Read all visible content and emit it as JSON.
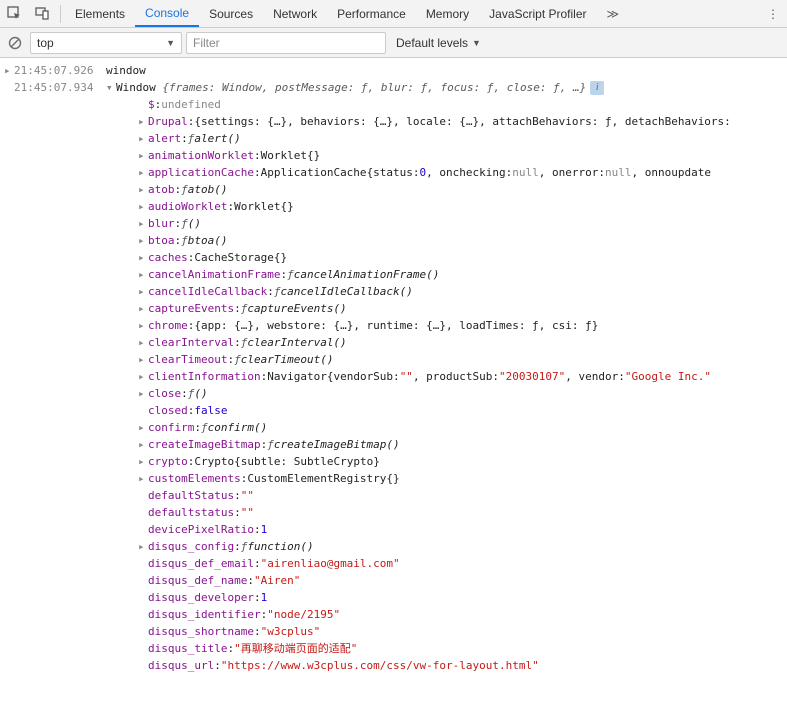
{
  "tabs": {
    "elements": "Elements",
    "console": "Console",
    "sources": "Sources",
    "network": "Network",
    "performance": "Performance",
    "memory": "Memory",
    "profiler": "JavaScript Profiler",
    "more": "≫"
  },
  "subbar": {
    "context": "top",
    "filter_placeholder": "Filter",
    "levels": "Default levels"
  },
  "log1": {
    "ts": "21:45:07.926",
    "text": "window"
  },
  "log2": {
    "ts": "21:45:07.934",
    "header_pre": "Window ",
    "header_body": "{frames: Window, postMessage: ƒ, blur: ƒ, focus: ƒ, close: ƒ, …}"
  },
  "props": {
    "dollar": {
      "k": "$",
      "v": "undefined"
    },
    "drupal": {
      "k": "Drupal",
      "v": "{settings: {…}, behaviors: {…}, locale: {…}, attachBehaviors: ƒ, detachBehaviors:"
    },
    "alert": {
      "k": "alert",
      "f": "ƒ ",
      "fn": "alert()"
    },
    "animationWorklet": {
      "k": "animationWorklet",
      "t": "Worklet ",
      "v": "{}"
    },
    "applicationCache": {
      "k": "applicationCache",
      "t": "ApplicationCache ",
      "v": "{status: ",
      "num": "0",
      "v2": ", onchecking: ",
      "n1": "null",
      "v3": ", onerror: ",
      "n2": "null",
      "v4": ", onnoupdate"
    },
    "atob": {
      "k": "atob",
      "f": "ƒ ",
      "fn": "atob()"
    },
    "audioWorklet": {
      "k": "audioWorklet",
      "t": "Worklet ",
      "v": "{}"
    },
    "blur": {
      "k": "blur",
      "f": "ƒ ",
      "fn": "()"
    },
    "btoa": {
      "k": "btoa",
      "f": "ƒ ",
      "fn": "btoa()"
    },
    "caches": {
      "k": "caches",
      "t": "CacheStorage ",
      "v": "{}"
    },
    "cancelAnimationFrame": {
      "k": "cancelAnimationFrame",
      "f": "ƒ ",
      "fn": "cancelAnimationFrame()"
    },
    "cancelIdleCallback": {
      "k": "cancelIdleCallback",
      "f": "ƒ ",
      "fn": "cancelIdleCallback()"
    },
    "captureEvents": {
      "k": "captureEvents",
      "f": "ƒ ",
      "fn": "captureEvents()"
    },
    "chrome": {
      "k": "chrome",
      "v": "{app: {…}, webstore: {…}, runtime: {…}, loadTimes: ƒ, csi: ƒ}"
    },
    "clearInterval": {
      "k": "clearInterval",
      "f": "ƒ ",
      "fn": "clearInterval()"
    },
    "clearTimeout": {
      "k": "clearTimeout",
      "f": "ƒ ",
      "fn": "clearTimeout()"
    },
    "clientInformation": {
      "k": "clientInformation",
      "t": "Navigator ",
      "v": "{vendorSub: ",
      "s1": "\"\"",
      "v2": ", productSub: ",
      "s2": "\"20030107\"",
      "v3": ", vendor: ",
      "s3": "\"Google Inc.\""
    },
    "close": {
      "k": "close",
      "f": "ƒ ",
      "fn": "()"
    },
    "closed": {
      "k": "closed",
      "v": "false"
    },
    "confirm": {
      "k": "confirm",
      "f": "ƒ ",
      "fn": "confirm()"
    },
    "createImageBitmap": {
      "k": "createImageBitmap",
      "f": "ƒ ",
      "fn": "createImageBitmap()"
    },
    "crypto": {
      "k": "crypto",
      "t": "Crypto ",
      "v": "{subtle: SubtleCrypto}"
    },
    "customElements": {
      "k": "customElements",
      "t": "CustomElementRegistry ",
      "v": "{}"
    },
    "defaultStatus": {
      "k": "defaultStatus",
      "s": "\"\""
    },
    "defaultstatus": {
      "k": "defaultstatus",
      "s": "\"\""
    },
    "devicePixelRatio": {
      "k": "devicePixelRatio",
      "n": "1"
    },
    "disqus_config": {
      "k": "disqus_config",
      "f": "ƒ ",
      "fn": "function()"
    },
    "disqus_def_email": {
      "k": "disqus_def_email",
      "s": "\"airenliao@gmail.com\""
    },
    "disqus_def_name": {
      "k": "disqus_def_name",
      "s": "\"Airen\""
    },
    "disqus_developer": {
      "k": "disqus_developer",
      "n": "1"
    },
    "disqus_identifier": {
      "k": "disqus_identifier",
      "s": "\"node/2195\""
    },
    "disqus_shortname": {
      "k": "disqus_shortname",
      "s": "\"w3cplus\""
    },
    "disqus_title": {
      "k": "disqus_title",
      "s": "\"再聊移动端页面的适配\""
    },
    "disqus_url": {
      "k": "disqus_url",
      "s": "\"https://www.w3cplus.com/css/vw-for-layout.html\""
    }
  }
}
